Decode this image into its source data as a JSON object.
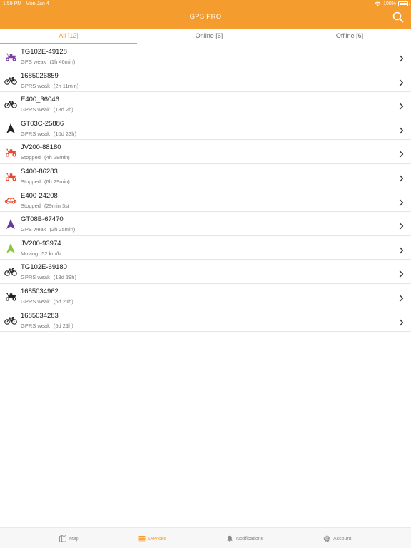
{
  "status_bar": {
    "time": "1:59 PM",
    "date": "Mon Jan 4",
    "battery": "100%"
  },
  "header": {
    "title": "GPS PRO",
    "search_icon": "search-icon"
  },
  "tabs": [
    {
      "label": "All [12]",
      "active": true
    },
    {
      "label": "Online [6]",
      "active": false
    },
    {
      "label": "Offline [6]",
      "active": false
    }
  ],
  "devices": [
    {
      "name": "TG102E-49128",
      "status": "GPS weak",
      "duration": "(1h 46min)",
      "icon": "scooter-icon",
      "color": "#7b3fa0"
    },
    {
      "name": "1685026859",
      "status": "GPRS weak",
      "duration": "(2h 11min)",
      "icon": "bicycle-icon",
      "color": "#222222"
    },
    {
      "name": "E400_36046",
      "status": "GPRS weak",
      "duration": "(18d 2h)",
      "icon": "bicycle-icon",
      "color": "#222222"
    },
    {
      "name": "GT03C-25886",
      "status": "GPRS weak",
      "duration": "(10d 23h)",
      "icon": "arrow-icon",
      "color": "#222222"
    },
    {
      "name": "JV200-88180",
      "status": "Stopped",
      "duration": "(4h 28min)",
      "icon": "scooter-icon",
      "color": "#e84a2f"
    },
    {
      "name": "S400-86283",
      "status": "Stopped",
      "duration": "(6h 29min)",
      "icon": "scooter-icon",
      "color": "#e84a2f"
    },
    {
      "name": "E400-24208",
      "status": "Stopped",
      "duration": "(29min 3s)",
      "icon": "car-icon",
      "color": "#e84a2f"
    },
    {
      "name": "GT08B-67470",
      "status": "GPS weak",
      "duration": "(2h 25min)",
      "icon": "arrow-icon",
      "color": "#6a3a9a"
    },
    {
      "name": "JV200-93974",
      "status": "Moving",
      "duration": "52 km/h",
      "icon": "arrow-icon",
      "color": "#8cc63f"
    },
    {
      "name": "TG102E-69180",
      "status": "GPRS weak",
      "duration": "(13d 19h)",
      "icon": "bicycle-icon",
      "color": "#222222"
    },
    {
      "name": "1685034962",
      "status": "GPRS weak",
      "duration": "(5d 21h)",
      "icon": "scooter-icon",
      "color": "#222222"
    },
    {
      "name": "1685034283",
      "status": "GPRS weak",
      "duration": "(5d 21h)",
      "icon": "bicycle-icon",
      "color": "#222222"
    }
  ],
  "bottom_nav": [
    {
      "label": "Map",
      "icon": "map-icon",
      "active": false
    },
    {
      "label": "Devices",
      "icon": "list-icon",
      "active": true
    },
    {
      "label": "Notifications",
      "icon": "bell-icon",
      "active": false
    },
    {
      "label": "Account",
      "icon": "gear-icon",
      "active": false
    }
  ],
  "colors": {
    "accent": "#f49c2e"
  }
}
